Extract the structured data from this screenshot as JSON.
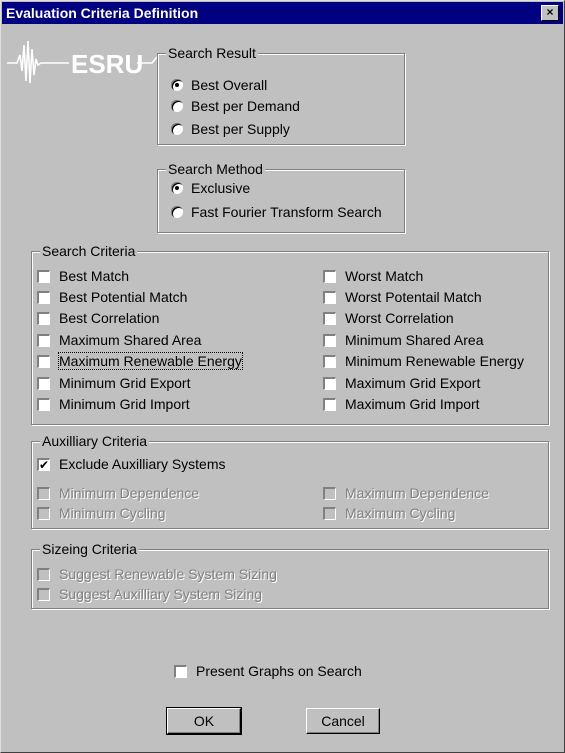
{
  "window": {
    "title": "Evaluation Criteria Definition",
    "close_glyph": "×"
  },
  "logo": {
    "text": "ESRU"
  },
  "search_result": {
    "legend": "Search Result",
    "options": [
      {
        "label": "Best Overall",
        "selected": true
      },
      {
        "label": "Best per Demand",
        "selected": false
      },
      {
        "label": "Best per Supply",
        "selected": false
      }
    ]
  },
  "search_method": {
    "legend": "Search Method",
    "options": [
      {
        "label": "Exclusive",
        "selected": true
      },
      {
        "label": "Fast Fourier Transform Search",
        "selected": false
      }
    ]
  },
  "search_criteria": {
    "legend": "Search Criteria",
    "left": [
      "Best Match",
      "Best Potential Match",
      "Best Correlation",
      "Maximum Shared Area",
      "Maximum Renewable Energy",
      "Minimum Grid Export",
      "Minimum Grid Import"
    ],
    "right": [
      "Worst Match",
      "Worst Potentail Match",
      "Worst Correlation",
      "Minimum Shared Area",
      "Minimum Renewable Energy",
      "Maximum Grid Export",
      "Maximum Grid Import"
    ]
  },
  "auxilliary_criteria": {
    "legend": "Auxilliary Criteria",
    "exclude_label": "Exclude Auxilliary Systems",
    "exclude_checked": true,
    "disabled_left": [
      "Minimum Dependence",
      "Minimum Cycling"
    ],
    "disabled_right": [
      "Maximum Dependence",
      "Maximum Cycling"
    ]
  },
  "sizing_criteria": {
    "legend": "Sizeing Criteria",
    "items": [
      "Suggest Renewable System Sizing",
      "Suggest Auxilliary System Sizing"
    ]
  },
  "present_graphs": {
    "label": "Present Graphs on Search",
    "checked": false
  },
  "buttons": {
    "ok": "OK",
    "cancel": "Cancel"
  }
}
